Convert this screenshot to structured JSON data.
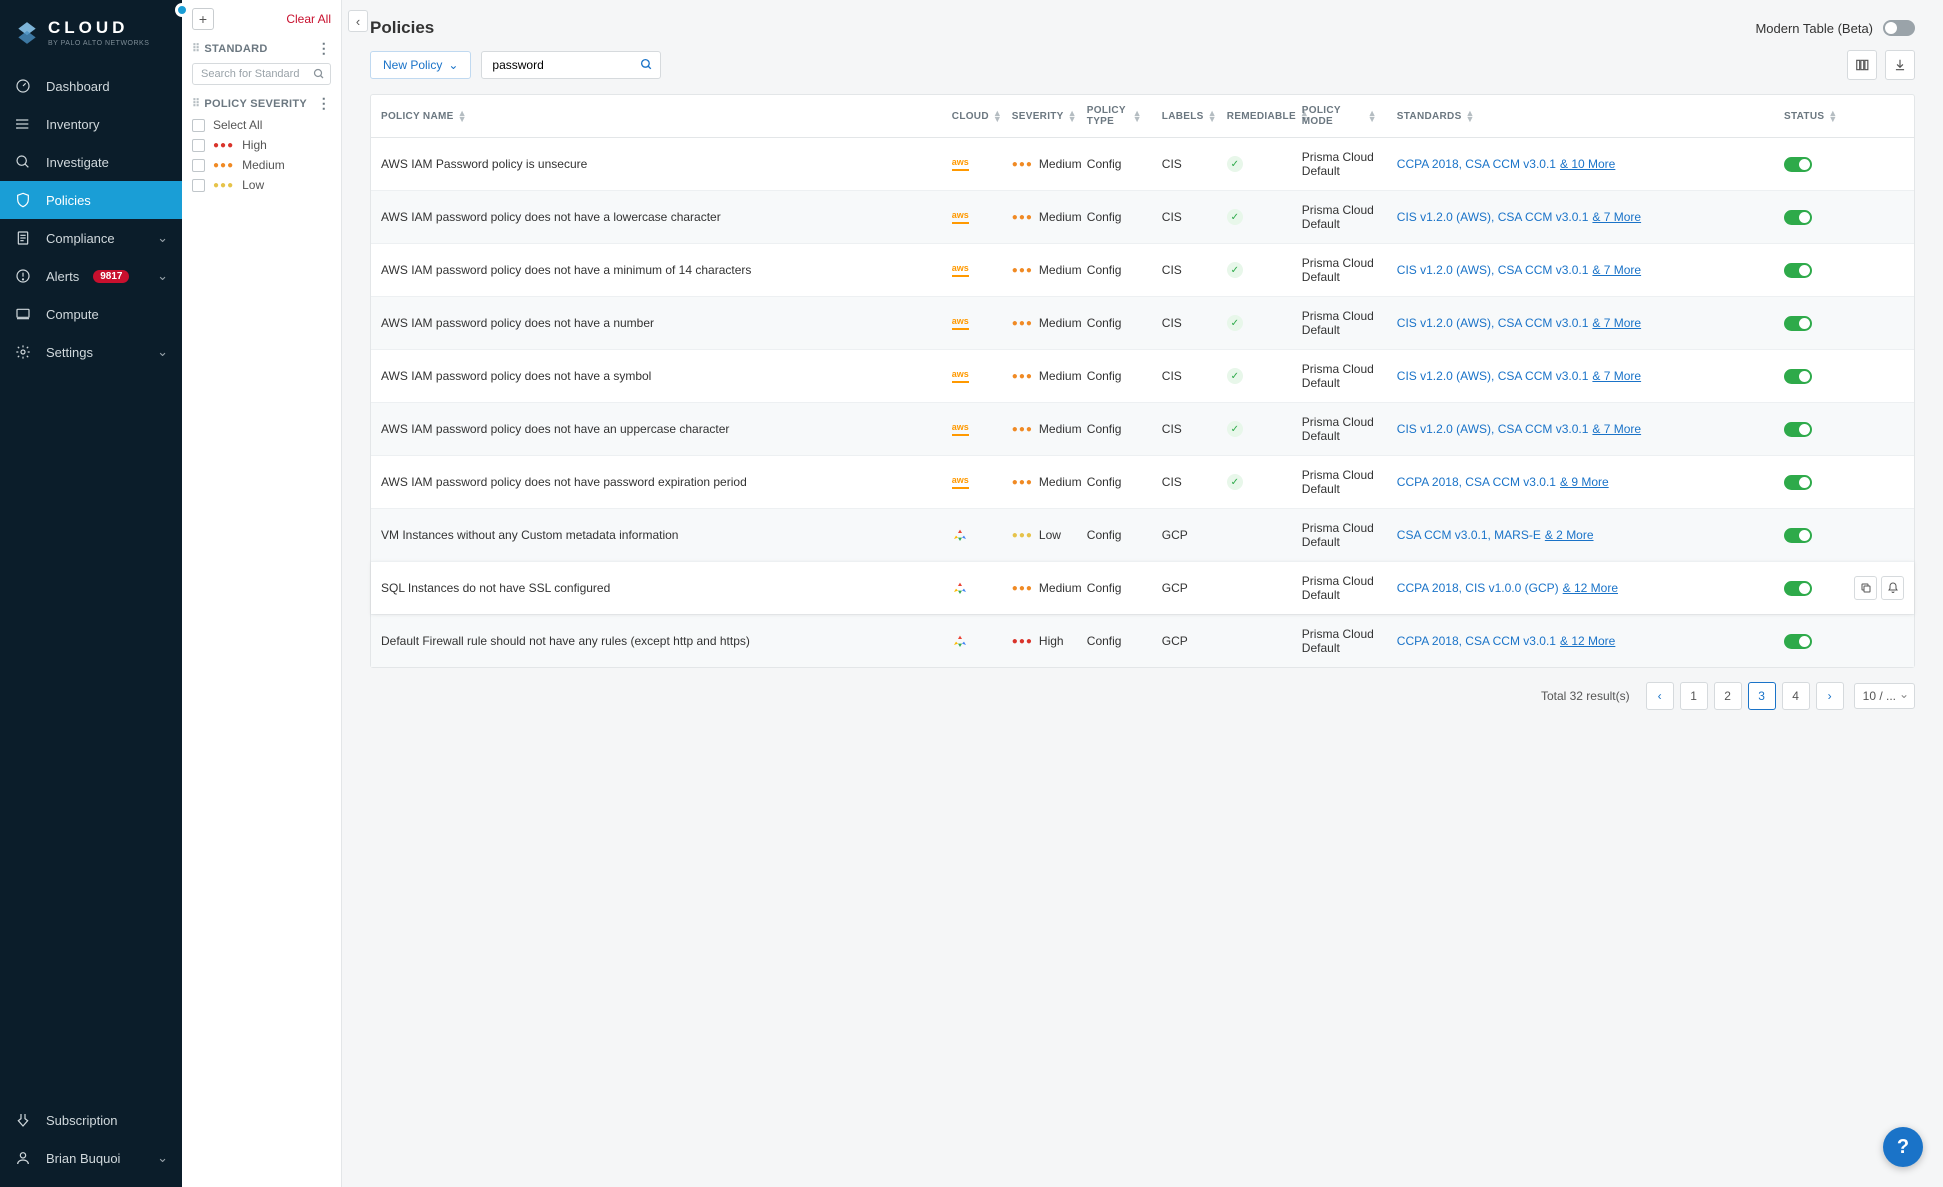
{
  "brand": {
    "name": "CLOUD",
    "sub": "BY PALO ALTO NETWORKS"
  },
  "sidebar": {
    "items": [
      {
        "label": "Dashboard",
        "icon": "dashboard"
      },
      {
        "label": "Inventory",
        "icon": "inventory"
      },
      {
        "label": "Investigate",
        "icon": "investigate"
      },
      {
        "label": "Policies",
        "icon": "policies",
        "active": true
      },
      {
        "label": "Compliance",
        "icon": "compliance",
        "expandable": true
      },
      {
        "label": "Alerts",
        "icon": "alerts",
        "badge": "9817",
        "expandable": true
      },
      {
        "label": "Compute",
        "icon": "compute"
      },
      {
        "label": "Settings",
        "icon": "settings",
        "expandable": true
      }
    ],
    "bottom": [
      {
        "label": "Subscription",
        "icon": "subscription"
      },
      {
        "label": "Brian Buquoi",
        "icon": "user",
        "expandable": true
      }
    ]
  },
  "filters": {
    "clear": "Clear All",
    "standard": {
      "title": "STANDARD",
      "placeholder": "Search for Standard"
    },
    "severity": {
      "title": "POLICY SEVERITY",
      "select_all": "Select All",
      "options": [
        {
          "label": "High",
          "level": "high"
        },
        {
          "label": "Medium",
          "level": "medium"
        },
        {
          "label": "Low",
          "level": "low"
        }
      ]
    }
  },
  "page": {
    "title": "Policies",
    "modern_label": "Modern Table (Beta)",
    "new_policy": "New Policy",
    "search_value": "password"
  },
  "table": {
    "columns": [
      "POLICY NAME",
      "CLOUD",
      "SEVERITY",
      "POLICY TYPE",
      "LABELS",
      "REMEDIABLE",
      "POLICY MODE",
      "STANDARDS",
      "STATUS"
    ],
    "rows": [
      {
        "name": "AWS IAM Password policy is unsecure",
        "cloud": "aws",
        "severity": "Medium",
        "sev_level": "medium",
        "type": "Config",
        "labels": "CIS",
        "remediable": true,
        "mode": "Prisma Cloud Default",
        "standards": "CCPA 2018, CSA CCM v3.0.1",
        "more": "& 10 More",
        "status": true
      },
      {
        "name": "AWS IAM password policy does not have a lowercase character",
        "cloud": "aws",
        "severity": "Medium",
        "sev_level": "medium",
        "type": "Config",
        "labels": "CIS",
        "remediable": true,
        "mode": "Prisma Cloud Default",
        "standards": "CIS v1.2.0 (AWS), CSA CCM v3.0.1",
        "more": "& 7 More",
        "status": true
      },
      {
        "name": "AWS IAM password policy does not have a minimum of 14 characters",
        "cloud": "aws",
        "severity": "Medium",
        "sev_level": "medium",
        "type": "Config",
        "labels": "CIS",
        "remediable": true,
        "mode": "Prisma Cloud Default",
        "standards": "CIS v1.2.0 (AWS), CSA CCM v3.0.1",
        "more": "& 7 More",
        "status": true
      },
      {
        "name": "AWS IAM password policy does not have a number",
        "cloud": "aws",
        "severity": "Medium",
        "sev_level": "medium",
        "type": "Config",
        "labels": "CIS",
        "remediable": true,
        "mode": "Prisma Cloud Default",
        "standards": "CIS v1.2.0 (AWS), CSA CCM v3.0.1",
        "more": "& 7 More",
        "status": true
      },
      {
        "name": "AWS IAM password policy does not have a symbol",
        "cloud": "aws",
        "severity": "Medium",
        "sev_level": "medium",
        "type": "Config",
        "labels": "CIS",
        "remediable": true,
        "mode": "Prisma Cloud Default",
        "standards": "CIS v1.2.0 (AWS), CSA CCM v3.0.1",
        "more": "& 7 More",
        "status": true
      },
      {
        "name": "AWS IAM password policy does not have an uppercase character",
        "cloud": "aws",
        "severity": "Medium",
        "sev_level": "medium",
        "type": "Config",
        "labels": "CIS",
        "remediable": true,
        "mode": "Prisma Cloud Default",
        "standards": "CIS v1.2.0 (AWS), CSA CCM v3.0.1",
        "more": "& 7 More",
        "status": true
      },
      {
        "name": "AWS IAM password policy does not have password expiration period",
        "cloud": "aws",
        "severity": "Medium",
        "sev_level": "medium",
        "type": "Config",
        "labels": "CIS",
        "remediable": true,
        "mode": "Prisma Cloud Default",
        "standards": "CCPA 2018, CSA CCM v3.0.1",
        "more": "& 9 More",
        "status": true
      },
      {
        "name": "VM Instances without any Custom metadata information",
        "cloud": "gcp",
        "severity": "Low",
        "sev_level": "low",
        "type": "Config",
        "labels": "GCP",
        "remediable": false,
        "mode": "Prisma Cloud Default",
        "standards": "CSA CCM v3.0.1, MARS-E",
        "more": "& 2 More",
        "status": true
      },
      {
        "name": "SQL Instances do not have SSL configured",
        "cloud": "gcp",
        "severity": "Medium",
        "sev_level": "medium",
        "type": "Config",
        "labels": "GCP",
        "remediable": false,
        "mode": "Prisma Cloud Default",
        "standards": "CCPA 2018, CIS v1.0.0 (GCP)",
        "more": "& 12 More",
        "status": true,
        "hovered": true
      },
      {
        "name": "Default Firewall rule should not have any rules (except http and https)",
        "cloud": "gcp",
        "severity": "High",
        "sev_level": "high",
        "type": "Config",
        "labels": "GCP",
        "remediable": false,
        "mode": "Prisma Cloud Default",
        "standards": "CCPA 2018, CSA CCM v3.0.1",
        "more": "& 12 More",
        "status": true
      }
    ]
  },
  "pagination": {
    "total": "Total 32 result(s)",
    "pages": [
      "1",
      "2",
      "3",
      "4"
    ],
    "active": "3",
    "size": "10 / ..."
  }
}
